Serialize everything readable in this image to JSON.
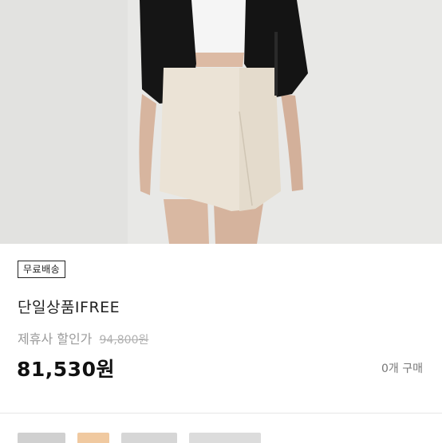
{
  "product": {
    "image_description": "Model wearing a black cardigan, white top and a beige wrap mini skirt",
    "shipping_badge": "무료배송",
    "name": "단일상품IFREE",
    "discount_label": "제휴사 할인가",
    "original_price": "94,800원",
    "sale_price": "81,530원",
    "purchase_count": "0개 구매"
  },
  "colors": {
    "skirt": "#e9e1d3",
    "cardigan": "#141414",
    "top": "#f4f4f4",
    "skin": "#d9b8a2",
    "background": "#e8e8e6"
  }
}
